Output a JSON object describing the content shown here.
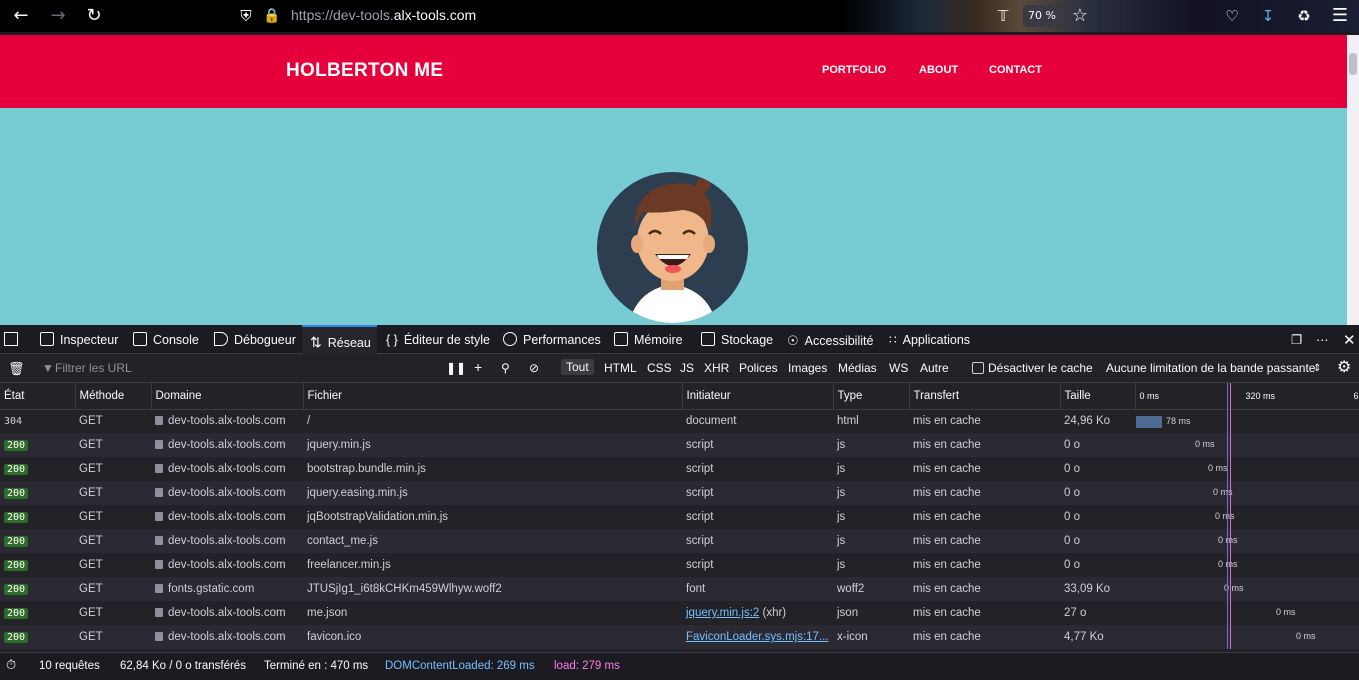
{
  "browser": {
    "url_prefix": "https://dev-tools.",
    "url_domain": "alx-tools.com",
    "zoom": "70 %"
  },
  "site": {
    "brand": "HOLBERTON ME",
    "nav": [
      "PORTFOLIO",
      "ABOUT",
      "CONTACT"
    ]
  },
  "devtools": {
    "tabs": [
      "Inspecteur",
      "Console",
      "Débogueur",
      "Réseau",
      "Éditeur de style",
      "Performances",
      "Mémoire",
      "Stockage",
      "Accessibilité",
      "Applications"
    ],
    "selected_tab": "Réseau",
    "filter_placeholder": "Filtrer les URL",
    "filters": [
      "Tout",
      "HTML",
      "CSS",
      "JS",
      "XHR",
      "Polices",
      "Images",
      "Médias",
      "WS",
      "Autre"
    ],
    "disable_cache": "Désactiver le cache",
    "throttle": "Aucune limitation de la bande passante",
    "columns": [
      "État",
      "Méthode",
      "Domaine",
      "Fichier",
      "Initiateur",
      "Type",
      "Transfert",
      "Taille"
    ],
    "timeline_ticks": [
      "0 ms",
      "320 ms",
      "6"
    ],
    "rows": [
      {
        "status": "304",
        "method": "GET",
        "domain": "dev-tools.alx-tools.com",
        "file": "/",
        "initiator": "document",
        "type": "html",
        "transfer": "mis en cache",
        "size": "24,96 Ko",
        "timing": "78 ms"
      },
      {
        "status": "200",
        "method": "GET",
        "domain": "dev-tools.alx-tools.com",
        "file": "jquery.min.js",
        "initiator": "script",
        "type": "js",
        "transfer": "mis en cache",
        "size": "0 o",
        "timing": "0 ms"
      },
      {
        "status": "200",
        "method": "GET",
        "domain": "dev-tools.alx-tools.com",
        "file": "bootstrap.bundle.min.js",
        "initiator": "script",
        "type": "js",
        "transfer": "mis en cache",
        "size": "0 o",
        "timing": "0 ms"
      },
      {
        "status": "200",
        "method": "GET",
        "domain": "dev-tools.alx-tools.com",
        "file": "jquery.easing.min.js",
        "initiator": "script",
        "type": "js",
        "transfer": "mis en cache",
        "size": "0 o",
        "timing": "0 ms"
      },
      {
        "status": "200",
        "method": "GET",
        "domain": "dev-tools.alx-tools.com",
        "file": "jqBootstrapValidation.min.js",
        "initiator": "script",
        "type": "js",
        "transfer": "mis en cache",
        "size": "0 o",
        "timing": "0 ms"
      },
      {
        "status": "200",
        "method": "GET",
        "domain": "dev-tools.alx-tools.com",
        "file": "contact_me.js",
        "initiator": "script",
        "type": "js",
        "transfer": "mis en cache",
        "size": "0 o",
        "timing": "0 ms"
      },
      {
        "status": "200",
        "method": "GET",
        "domain": "dev-tools.alx-tools.com",
        "file": "freelancer.min.js",
        "initiator": "script",
        "type": "js",
        "transfer": "mis en cache",
        "size": "0 o",
        "timing": "0 ms"
      },
      {
        "status": "200",
        "method": "GET",
        "domain": "fonts.gstatic.com",
        "file": "JTUSjIg1_i6t8kCHKm459Wlhyw.woff2",
        "initiator": "font",
        "type": "woff2",
        "transfer": "mis en cache",
        "size": "33,09 Ko",
        "timing": "0 ms"
      },
      {
        "status": "200",
        "method": "GET",
        "domain": "dev-tools.alx-tools.com",
        "file": "me.json",
        "initiator": "jquery.min.js:2",
        "initiator_suffix": " (xhr)",
        "type": "json",
        "transfer": "mis en cache",
        "size": "27 o",
        "timing": "0 ms"
      },
      {
        "status": "200",
        "method": "GET",
        "domain": "dev-tools.alx-tools.com",
        "file": "favicon.ico",
        "initiator": "FaviconLoader.sys.mjs:17...",
        "type": "x-icon",
        "transfer": "mis en cache",
        "size": "4,77 Ko",
        "timing": "0 ms"
      }
    ],
    "summary": {
      "requests": "10 requêtes",
      "transferred": "62,84 Ko / 0 o transférés",
      "finished": "Terminé en : 470 ms",
      "dcl": "DOMContentLoaded: 269 ms",
      "load": "load: 279 ms"
    },
    "colors": {
      "dcl": "#75bfff",
      "load": "#ff7de9",
      "status_ok": "#2d6b2a"
    }
  }
}
